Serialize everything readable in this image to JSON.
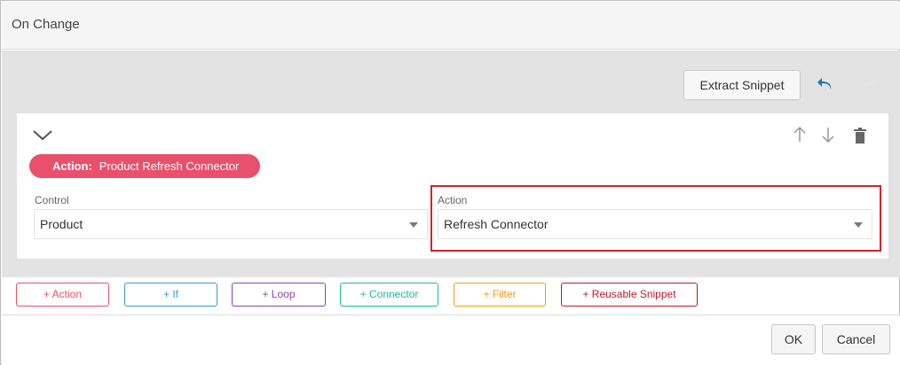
{
  "dialog": {
    "title": "On Change"
  },
  "toolbar": {
    "extract_snippet_label": "Extract Snippet",
    "undo_icon": "undo-icon",
    "redo_icon": "redo-icon",
    "accent_color": "#1e73be"
  },
  "action_card": {
    "badge_key": "Action:",
    "badge_value": "Product Refresh Connector",
    "badge_color": "#e8506b",
    "control": {
      "label": "Control",
      "value": "Product"
    },
    "action": {
      "label": "Action",
      "value": "Refresh Connector"
    }
  },
  "add_buttons": [
    {
      "label": "+ Action",
      "color": "#e8506b"
    },
    {
      "label": "+ If",
      "color": "#3a9ad9"
    },
    {
      "label": "+ Loop",
      "color": "#8e44ad"
    },
    {
      "label": "+ Connector",
      "color": "#1abc9c"
    },
    {
      "label": "+ Filter",
      "color": "#f39c12"
    },
    {
      "label": "+ Reusable Snippet",
      "color": "#c0182a"
    }
  ],
  "footer": {
    "ok_label": "OK",
    "cancel_label": "Cancel"
  },
  "highlight_color": "#d2222d"
}
